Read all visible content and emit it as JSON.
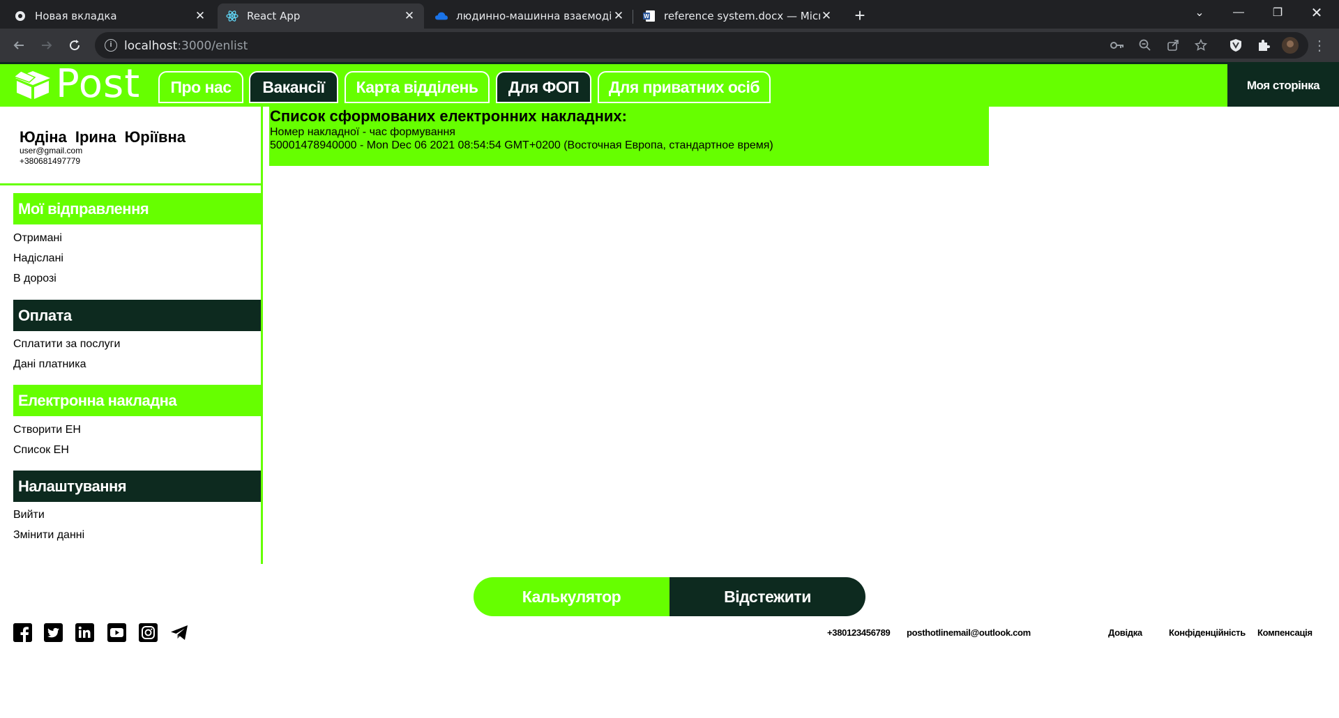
{
  "browser": {
    "tabs": [
      {
        "title": "Новая вкладка",
        "icon": "chrome-icon"
      },
      {
        "title": "React App",
        "icon": "react-icon"
      },
      {
        "title": "людинно-машинна взаємодія –",
        "icon": "onedrive-icon"
      },
      {
        "title": "reference system.docx — Micros",
        "icon": "word-icon"
      }
    ],
    "url_host": "localhost",
    "url_path": ":3000/enlist"
  },
  "header": {
    "logo_text": "Post",
    "nav": [
      {
        "label": "Про нас"
      },
      {
        "label": "Вакансії"
      },
      {
        "label": "Карта відділень"
      },
      {
        "label": "Для ФОП"
      },
      {
        "label": "Для приватних осіб"
      }
    ],
    "my_page": "Моя сторінка"
  },
  "profile": {
    "name": "Юдіна Ірина Юріївна",
    "email": "user@gmail.com",
    "phone": "+380681497779"
  },
  "sidebar": {
    "sections": [
      {
        "title": "Мої відправлення",
        "links": [
          "Отримані",
          "Надіслані",
          "В дорозі"
        ]
      },
      {
        "title": "Оплата",
        "links": [
          "Сплатити за послуги",
          "Дані платника"
        ]
      },
      {
        "title": "Електронна накладна",
        "links": [
          "Створити ЕН",
          "Список ЕН"
        ]
      },
      {
        "title": "Налаштування",
        "links": [
          "Вийти",
          "Змінити данні"
        ]
      }
    ]
  },
  "content": {
    "title": "Список сформованих електронних накладних:",
    "subtitle": "Номер накладної - час формування",
    "entries": [
      "50001478940000 - Mon Dec 06 2021 08:54:54 GMT+0200 (Восточная Европа, стандартное время)"
    ]
  },
  "cta": {
    "calculator": "Калькулятор",
    "track": "Відстежити"
  },
  "footer": {
    "phone": "+380123456789",
    "email": "posthotlinemail@outlook.com",
    "links": [
      "Довідка",
      "Конфіденційність",
      "Компенсація"
    ],
    "social": [
      "facebook-icon",
      "twitter-icon",
      "linkedin-icon",
      "youtube-icon",
      "instagram-icon",
      "telegram-icon"
    ]
  },
  "colors": {
    "accent": "#66ff00",
    "dark": "#0d2a1f"
  }
}
